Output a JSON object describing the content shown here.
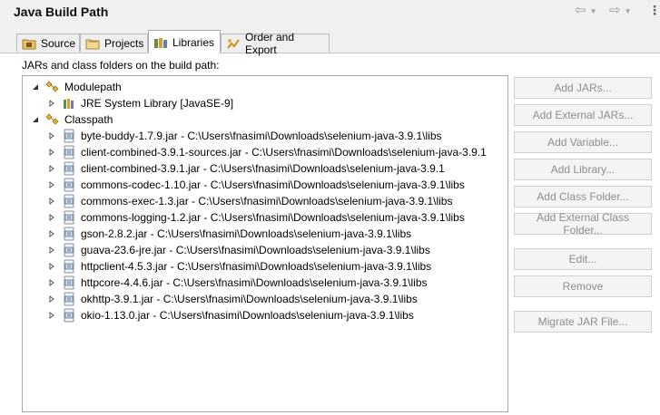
{
  "header": {
    "title": "Java Build Path"
  },
  "tabs": [
    {
      "label": "Source"
    },
    {
      "label": "Projects"
    },
    {
      "label": "Libraries"
    },
    {
      "label": "Order and Export"
    }
  ],
  "panel": {
    "label": "JARs and class folders on the build path:"
  },
  "tree": {
    "modulepath": {
      "label": "Modulepath",
      "children": [
        {
          "label": "JRE System Library [JavaSE-9]"
        }
      ]
    },
    "classpath": {
      "label": "Classpath",
      "children": [
        {
          "label": "byte-buddy-1.7.9.jar - C:\\Users\\fnasimi\\Downloads\\selenium-java-3.9.1\\libs"
        },
        {
          "label": "client-combined-3.9.1-sources.jar - C:\\Users\\fnasimi\\Downloads\\selenium-java-3.9.1"
        },
        {
          "label": "client-combined-3.9.1.jar - C:\\Users\\fnasimi\\Downloads\\selenium-java-3.9.1"
        },
        {
          "label": "commons-codec-1.10.jar - C:\\Users\\fnasimi\\Downloads\\selenium-java-3.9.1\\libs"
        },
        {
          "label": "commons-exec-1.3.jar - C:\\Users\\fnasimi\\Downloads\\selenium-java-3.9.1\\libs"
        },
        {
          "label": "commons-logging-1.2.jar - C:\\Users\\fnasimi\\Downloads\\selenium-java-3.9.1\\libs"
        },
        {
          "label": "gson-2.8.2.jar - C:\\Users\\fnasimi\\Downloads\\selenium-java-3.9.1\\libs"
        },
        {
          "label": "guava-23.6-jre.jar - C:\\Users\\fnasimi\\Downloads\\selenium-java-3.9.1\\libs"
        },
        {
          "label": "httpclient-4.5.3.jar - C:\\Users\\fnasimi\\Downloads\\selenium-java-3.9.1\\libs"
        },
        {
          "label": "httpcore-4.4.6.jar - C:\\Users\\fnasimi\\Downloads\\selenium-java-3.9.1\\libs"
        },
        {
          "label": "okhttp-3.9.1.jar - C:\\Users\\fnasimi\\Downloads\\selenium-java-3.9.1\\libs"
        },
        {
          "label": "okio-1.13.0.jar - C:\\Users\\fnasimi\\Downloads\\selenium-java-3.9.1\\libs"
        }
      ]
    }
  },
  "buttons": {
    "add_jars": "Add JARs...",
    "add_external_jars": "Add External JARs...",
    "add_variable": "Add Variable...",
    "add_library": "Add Library...",
    "add_class_folder": "Add Class Folder...",
    "add_external_class_folder": "Add External Class Folder...",
    "edit": "Edit...",
    "remove": "Remove",
    "migrate_jar": "Migrate JAR File..."
  },
  "colors": {
    "chrome_bg": "#f0f0f0",
    "disabled_text": "#8e8e8e",
    "border": "#a9a9a9"
  },
  "icons": {
    "back": "back-arrow-icon",
    "forward": "forward-arrow-icon",
    "source_tab": "source-folder-icon",
    "projects_tab": "projects-icon",
    "libraries_tab": "libraries-icon",
    "order_tab": "order-export-icon",
    "container": "library-container-icon",
    "jar": "jar-file-icon"
  }
}
